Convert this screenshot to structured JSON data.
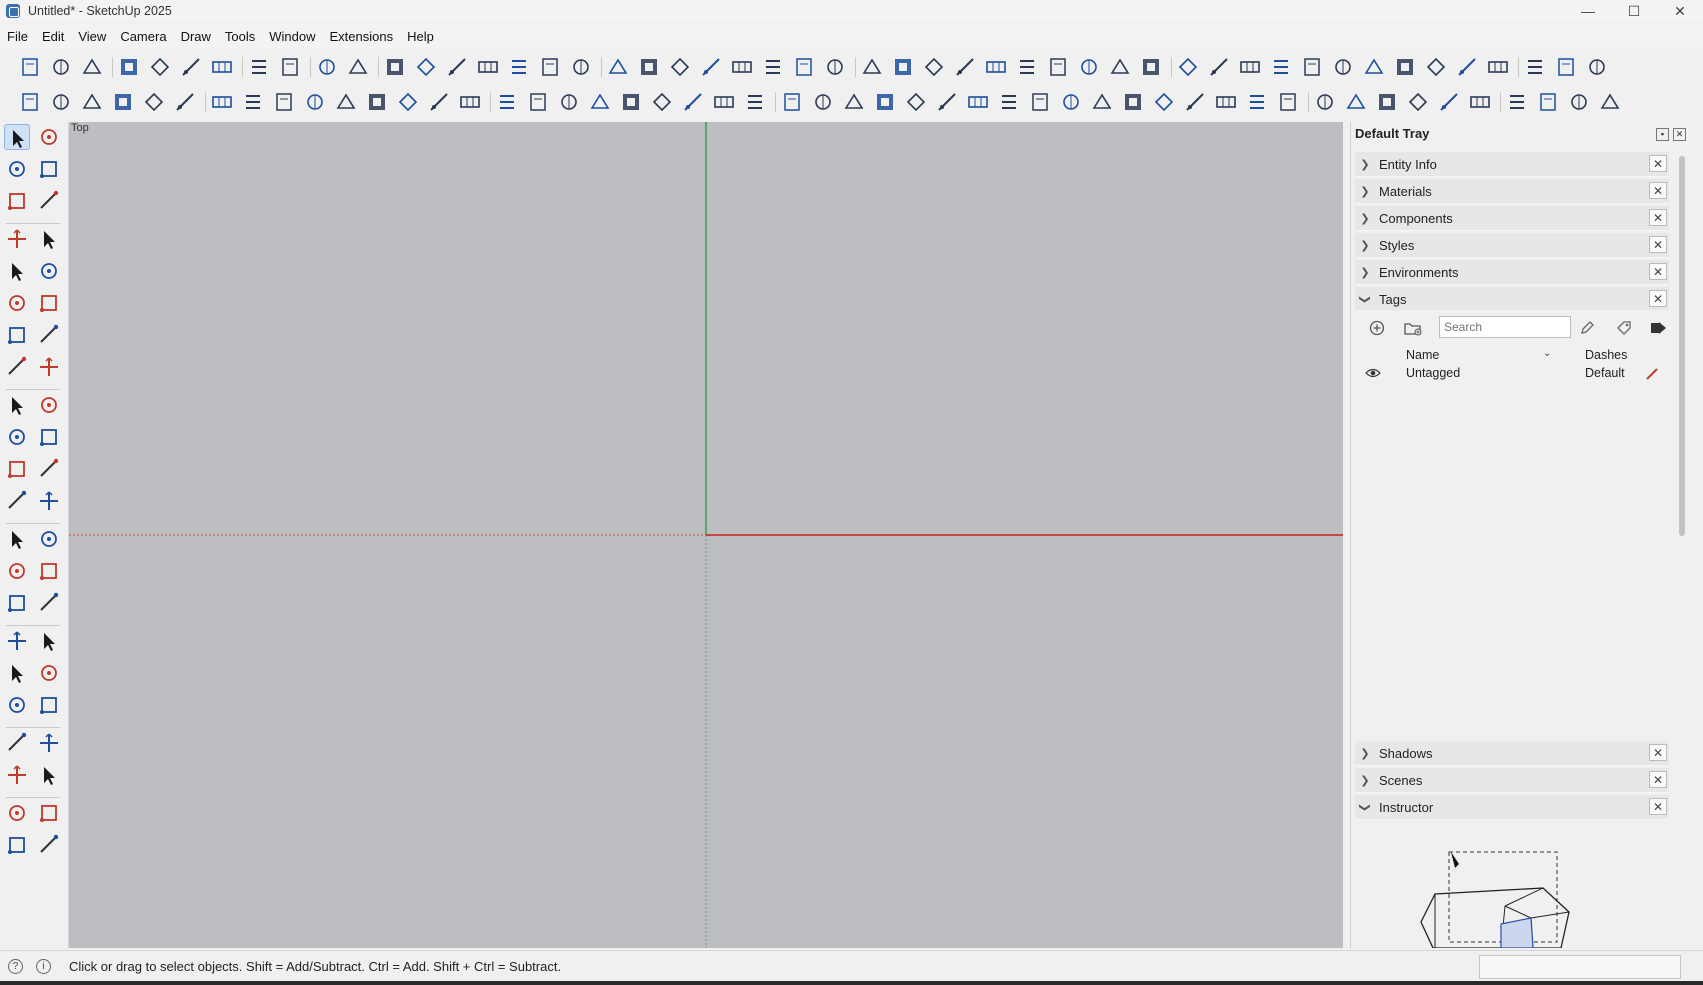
{
  "window": {
    "title": "Untitled* - SketchUp 2025",
    "controls": [
      "—",
      "☐",
      "✕"
    ]
  },
  "menu": [
    "File",
    "Edit",
    "View",
    "Camera",
    "Draw",
    "Tools",
    "Window",
    "Extensions",
    "Help"
  ],
  "toolbar_row1": [
    "new-file-icon",
    "open-folder-icon",
    "save-icon",
    "cut-icon",
    "copy-icon",
    "paste-icon",
    "delete-icon",
    "undo-icon",
    "redo-icon",
    "print-icon",
    "model-info-icon",
    "iso-view-icon",
    "top-view-icon",
    "front-view-icon",
    "right-view-icon",
    "back-view-icon",
    "left-view-icon",
    "bottom-view-icon",
    "zoom-window-icon",
    "angle-dimension-icon",
    "vertical-dimension-icon",
    "slope-icon",
    "flip-icon",
    "stack-icon",
    "lock-number-icon",
    "ramp-icon",
    "tower-icon",
    "cars-icon",
    "grid-icon",
    "stairs-icon",
    "text-box-icon",
    "explode-icon",
    "auto-icon",
    "graph-icon",
    "network-icon",
    "export-icon",
    "house-icon",
    "text-icon",
    "tree-icon",
    "pin-icon",
    "axes-icon",
    "cube-icon",
    "mesh-icon",
    "pin-box-icon",
    "scale-icon",
    "hide-icon",
    "triangle-icon",
    "expand-icon",
    "cross-tool-icon",
    "compress-icon"
  ],
  "toolbar_row2": [
    "menu-lines-icon",
    "sun-icon",
    "globe-icon",
    "frame-icon",
    "tent-icon",
    "mountain-icon",
    "columns-icon",
    "slab-icon",
    "grid-blocks-icon",
    "ramp-flat-icon",
    "bin-icon",
    "percent-icon",
    "star-tool-icon",
    "spark-tool-icon",
    "hook-icon",
    "matrix-icon",
    "chip-icon",
    "swap-icon",
    "spiral-icon",
    "check-curve-icon",
    "zoom-extents-icon",
    "anchor-icon",
    "link-icon",
    "ruler-bar-icon",
    "axis-tool-icon",
    "box-tool-icon",
    "medical-icon",
    "cloud-cad-icon",
    "measure-tape-icon",
    "branch-icon",
    "chart-icon",
    "wedge-icon",
    "split-icon",
    "table-icon",
    "sliders-icon",
    "dropbox-icon",
    "layers-icon",
    "yen-icon",
    "kwh-icon",
    "irr-icon",
    "clipboard-icon",
    "settings-gear-icon",
    "users-icon",
    "export-en-icon",
    "help-circle-icon",
    "cloud-upload-icon",
    "refresh-icon",
    "database-icon",
    "loss-icon",
    "bi-icon",
    "play-icon"
  ],
  "viewport": {
    "scene_label": "Top"
  },
  "tray": {
    "title": "Default Tray",
    "panels_top": [
      {
        "label": "Entity Info",
        "expanded": false
      },
      {
        "label": "Materials",
        "expanded": false
      },
      {
        "label": "Components",
        "expanded": false
      },
      {
        "label": "Styles",
        "expanded": false
      },
      {
        "label": "Environments",
        "expanded": false
      },
      {
        "label": "Tags",
        "expanded": true
      }
    ],
    "tags": {
      "search_placeholder": "Search",
      "col_name": "Name",
      "col_dashes": "Dashes",
      "rows": [
        {
          "name": "Untagged",
          "dashes": "Default",
          "visible": true
        }
      ]
    },
    "panels_bottom": [
      {
        "label": "Shadows",
        "expanded": false
      },
      {
        "label": "Scenes",
        "expanded": false
      },
      {
        "label": "Instructor",
        "expanded": true
      }
    ]
  },
  "status": {
    "message": "Click or drag to select objects. Shift = Add/Subtract. Ctrl = Add. Shift + Ctrl = Subtract."
  },
  "colors": {
    "viewport_bg": "#bdbec2",
    "green_axis": "#2ea043",
    "red_axis": "#d11f1f",
    "accent_blue": "#1e4f9c"
  }
}
